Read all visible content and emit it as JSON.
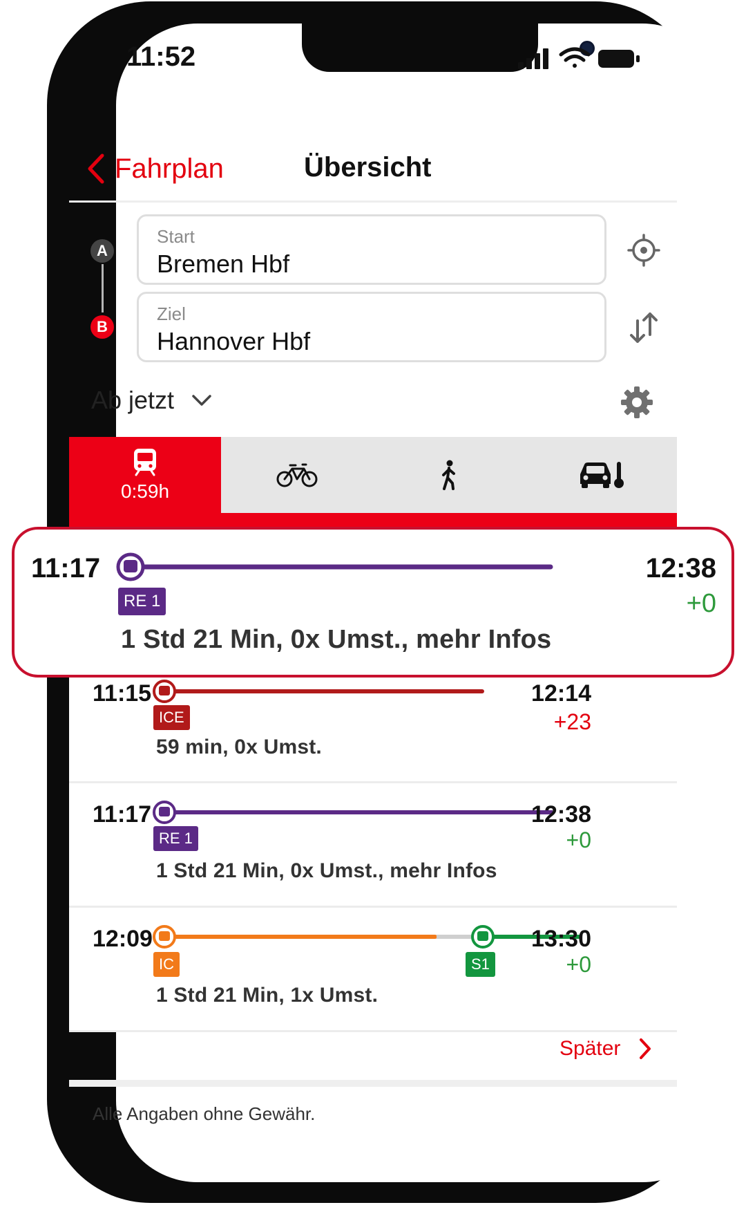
{
  "status_bar": {
    "time": "11:52"
  },
  "nav": {
    "back_label": "Fahrplan",
    "title": "Übersicht"
  },
  "search": {
    "start": {
      "label": "Start",
      "value": "Bremen Hbf",
      "marker": "A"
    },
    "destination": {
      "label": "Ziel",
      "value": "Hannover Hbf",
      "marker": "B"
    },
    "time_option": "Ab jetzt"
  },
  "modes": [
    {
      "name": "train-icon",
      "duration": "0:59h",
      "active": true
    },
    {
      "name": "bicycle-icon",
      "active": false
    },
    {
      "name": "walking-icon",
      "active": false
    },
    {
      "name": "car-icon",
      "active": false
    }
  ],
  "highlight": {
    "departure": "11:17",
    "arrival": "12:38",
    "delay": "+0",
    "train": "RE 1",
    "info": "1 Std 21 Min,  0x Umst.,  mehr Infos"
  },
  "connections": [
    {
      "departure": "11:15",
      "arrival": "12:14",
      "delay": "+23",
      "train": "ICE",
      "info": "59 min,  0x Umst."
    },
    {
      "departure": "11:17",
      "arrival": "12:38",
      "delay": "+0",
      "train": "RE 1",
      "info": "1 Std 21 Min,  0x Umst.,  mehr Infos"
    },
    {
      "departure": "12:09",
      "arrival": "13:30",
      "delay": "+0",
      "train": "IC",
      "train2": "S1",
      "info": "1 Std 21 Min,  1x Umst."
    }
  ],
  "later_label": "Später",
  "footer": "Alle Angaben ohne Gewähr.",
  "colors": {
    "db_red": "#ec0016",
    "re_purple": "#5b2a86",
    "ice_red": "#b11a1a",
    "ic_orange": "#f27a1a",
    "s_green": "#13963f",
    "ontime_green": "#2e9a3c",
    "delay_red": "#e3000f"
  }
}
